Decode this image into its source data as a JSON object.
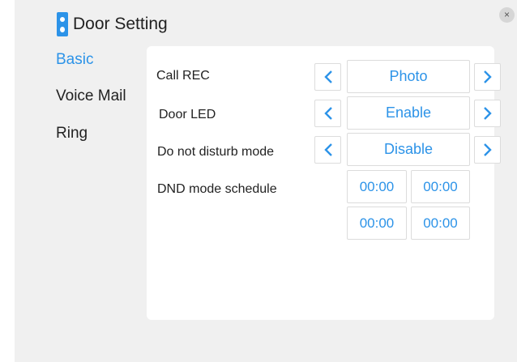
{
  "header": {
    "title": "Door Setting",
    "close_icon": "×"
  },
  "sidebar": {
    "items": [
      {
        "label": "Basic"
      },
      {
        "label": "Voice Mail"
      },
      {
        "label": "Ring"
      }
    ]
  },
  "settings": {
    "call_rec": {
      "label": "Call REC",
      "value": "Photo"
    },
    "door_led": {
      "label": "Door LED",
      "value": "Enable"
    },
    "dnd_mode": {
      "label": "Do not disturb mode",
      "value": "Disable"
    },
    "dnd_schedule": {
      "label": "DND mode schedule",
      "times": [
        "00:00",
        "00:00",
        "00:00",
        "00:00"
      ]
    }
  },
  "colors": {
    "accent": "#2c93e8",
    "panel_bg": "#f0f0f0",
    "content_bg": "#ffffff"
  }
}
